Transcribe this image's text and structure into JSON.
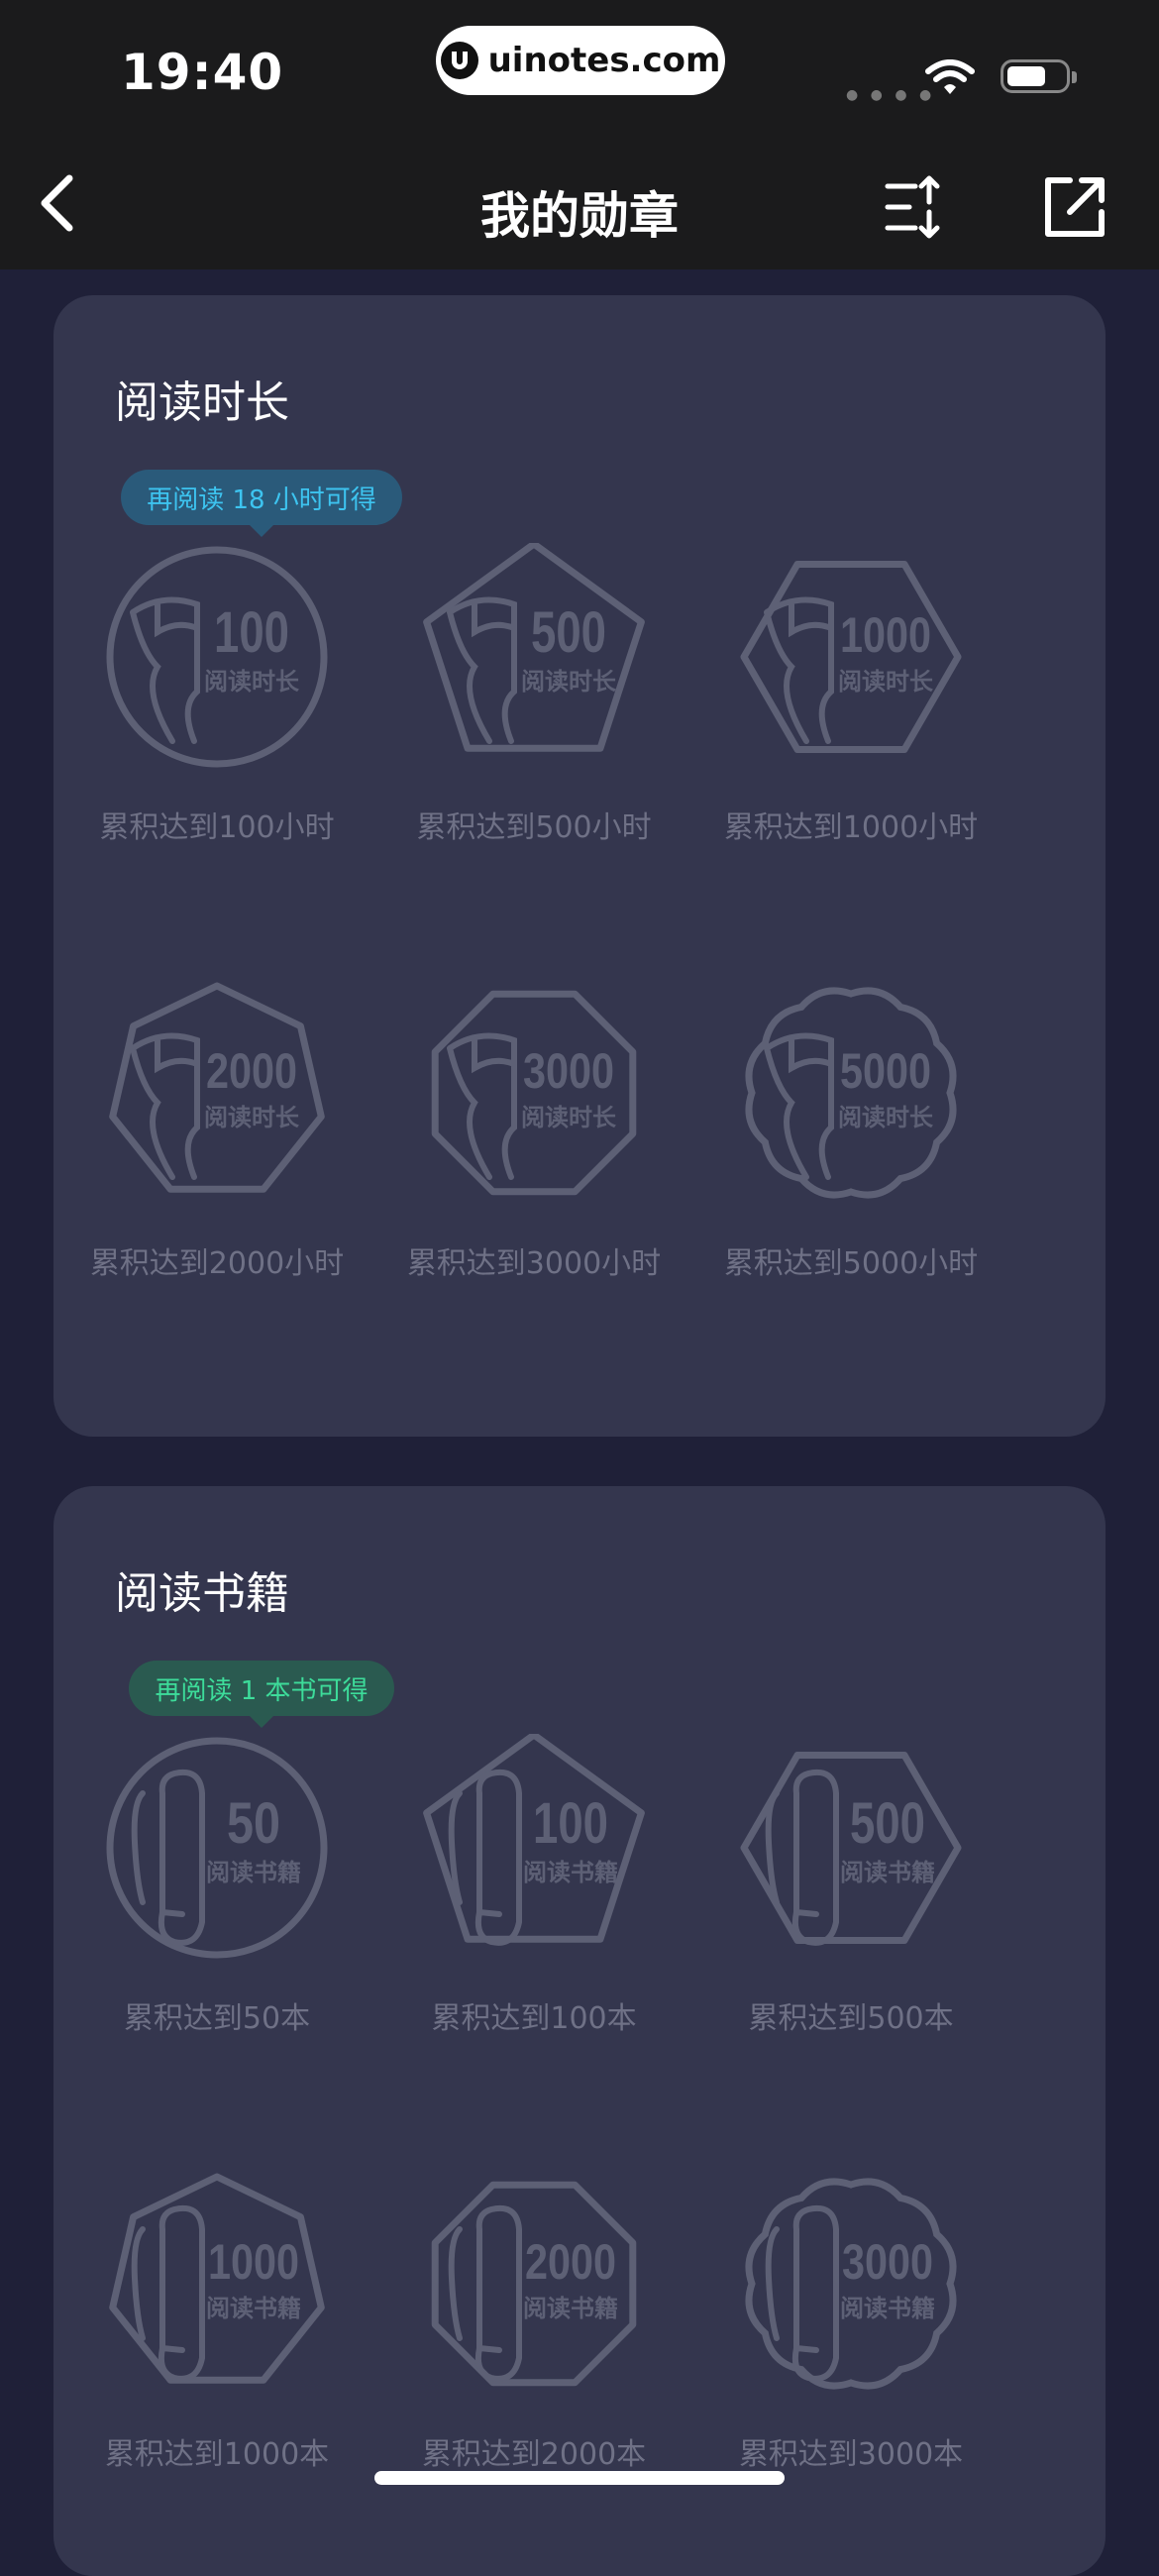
{
  "status_bar": {
    "time": "19:40",
    "watermark": "uinotes.com"
  },
  "nav": {
    "title": "我的勋章"
  },
  "sections": [
    {
      "title": "阅读时长",
      "tip": "再阅读 18 小时可得",
      "icon": "scroll-icon",
      "badges": [
        {
          "number": "100",
          "caption": "阅读时长",
          "label": "累积达到100小时",
          "shape": "circle"
        },
        {
          "number": "500",
          "caption": "阅读时长",
          "label": "累积达到500小时",
          "shape": "pentagon"
        },
        {
          "number": "1000",
          "caption": "阅读时长",
          "label": "累积达到1000小时",
          "shape": "hexagon"
        },
        {
          "number": "2000",
          "caption": "阅读时长",
          "label": "累积达到2000小时",
          "shape": "heptagon"
        },
        {
          "number": "3000",
          "caption": "阅读时长",
          "label": "累积达到3000小时",
          "shape": "octagon"
        },
        {
          "number": "5000",
          "caption": "阅读时长",
          "label": "累积达到5000小时",
          "shape": "scallop"
        }
      ]
    },
    {
      "title": "阅读书籍",
      "tip": "再阅读 1 本书可得",
      "icon": "book-scroll-icon",
      "badges": [
        {
          "number": "50",
          "caption": "阅读书籍",
          "label": "累积达到50本",
          "shape": "circle"
        },
        {
          "number": "100",
          "caption": "阅读书籍",
          "label": "累积达到100本",
          "shape": "pentagon"
        },
        {
          "number": "500",
          "caption": "阅读书籍",
          "label": "累积达到500本",
          "shape": "hexagon"
        },
        {
          "number": "1000",
          "caption": "阅读书籍",
          "label": "累积达到1000本",
          "shape": "heptagon"
        },
        {
          "number": "2000",
          "caption": "阅读书籍",
          "label": "累积达到2000本",
          "shape": "octagon"
        },
        {
          "number": "3000",
          "caption": "阅读书籍",
          "label": "累积达到3000本",
          "shape": "scallop"
        }
      ]
    }
  ],
  "colors": {
    "background": "#1f2038",
    "card": "#34364e",
    "badge_stroke": "#5d6075",
    "tip_blue": "#3dc4f0",
    "tip_green": "#3ddc9a"
  }
}
